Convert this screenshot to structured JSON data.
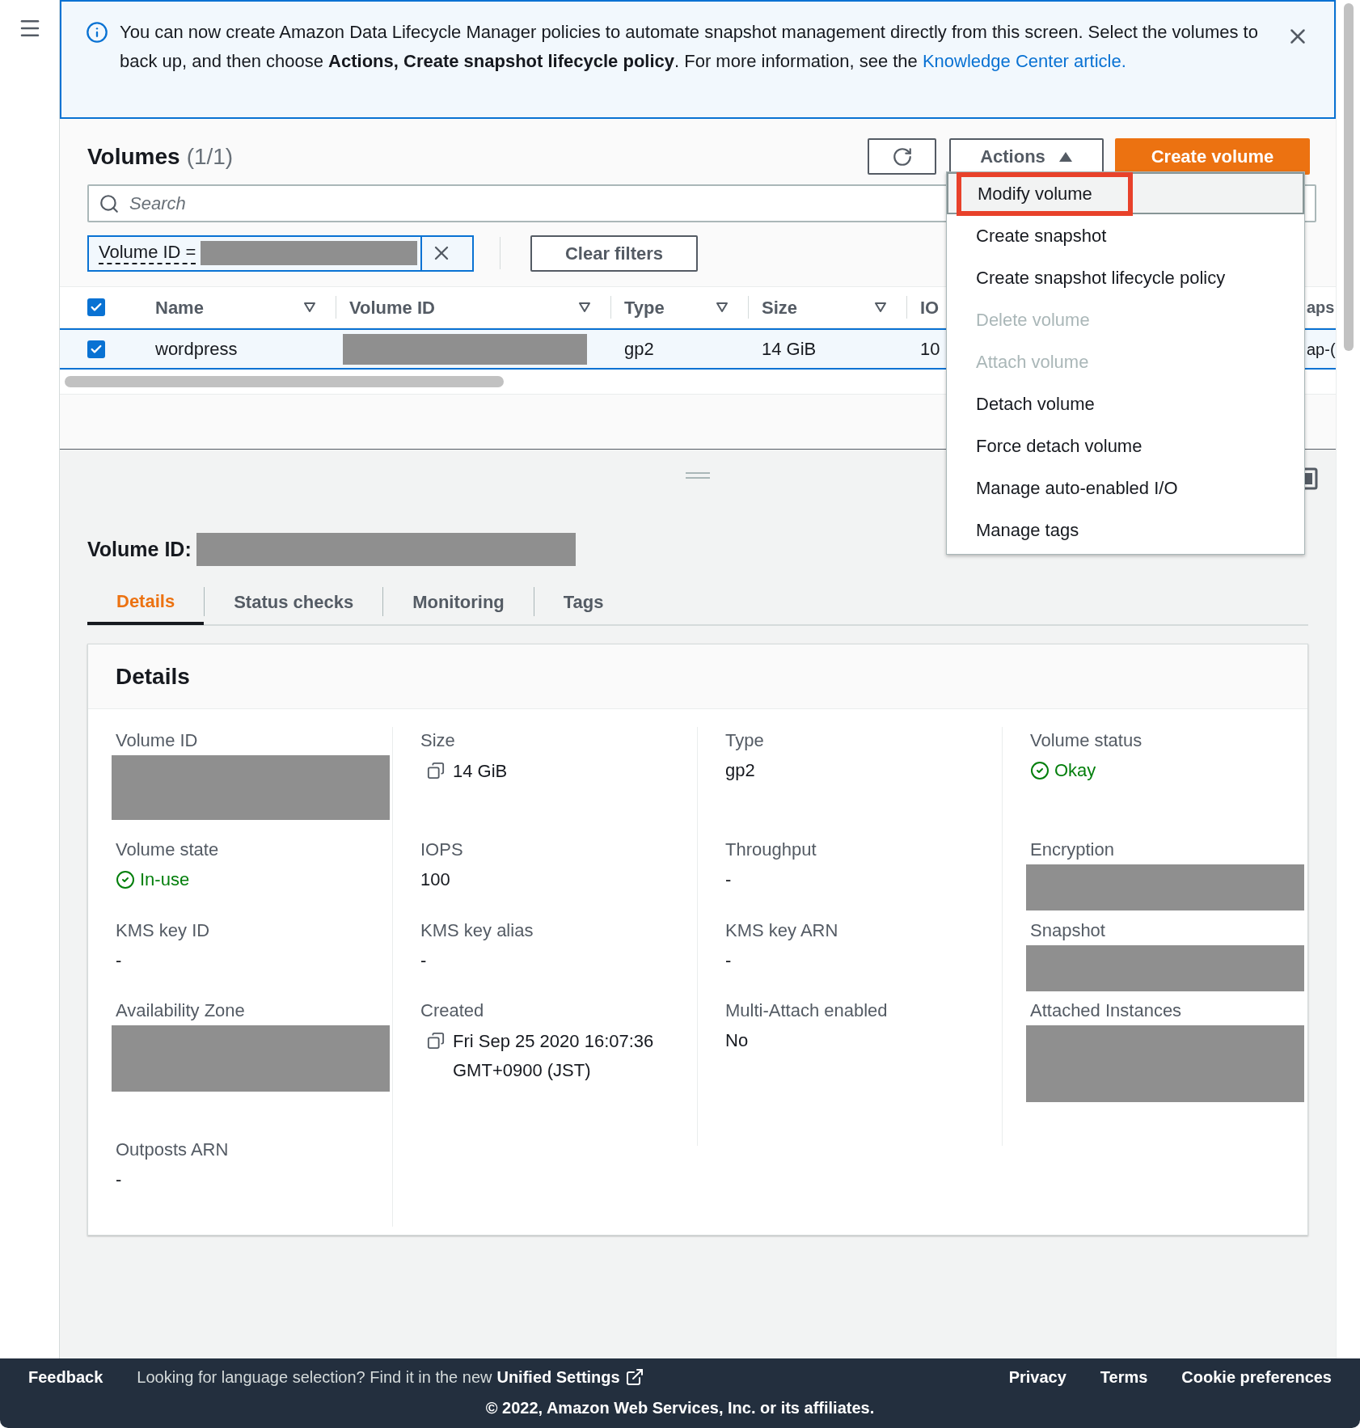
{
  "banner": {
    "text": "You can now create Amazon Data Lifecycle Manager policies to automate snapshot management directly from this screen. Select the volumes to back up, and then choose **Actions, Create snapshot lifecycle policy**. For more information, see the",
    "link": "Knowledge Center article."
  },
  "volumes": {
    "title": "Volumes",
    "count": "(1/1)",
    "actions_label": "Actions",
    "create_label": "Create volume",
    "search_placeholder": "Search",
    "filter_label": "Volume ID =",
    "clear_label": "Clear filters"
  },
  "table": {
    "select_all": true,
    "columns": [
      {
        "label": "Name",
        "filter": true
      },
      {
        "label": "Volume ID",
        "filter": true
      },
      {
        "label": "Type",
        "filter": true
      },
      {
        "label": "Size",
        "filter": true
      },
      {
        "label": "IO",
        "filter": false
      },
      {
        "label": "aps",
        "filter": false
      }
    ],
    "rows": [
      {
        "selected": true,
        "cells": [
          {
            "kind": "text",
            "text": "wordpress"
          },
          {
            "kind": "redacted"
          },
          {
            "kind": "text",
            "text": "gp2"
          },
          {
            "kind": "text",
            "text": "14 GiB"
          },
          {
            "kind": "text",
            "text": "10"
          },
          {
            "kind": "text",
            "text": "ap-("
          }
        ]
      }
    ]
  },
  "menu": [
    {
      "label": "Modify volume",
      "selected": true,
      "disabled": false
    },
    {
      "label": "Create snapshot",
      "selected": false,
      "disabled": false
    },
    {
      "label": "Create snapshot lifecycle policy",
      "selected": false,
      "disabled": false
    },
    {
      "label": "Delete volume",
      "selected": false,
      "disabled": true
    },
    {
      "label": "Attach volume",
      "selected": false,
      "disabled": true
    },
    {
      "label": "Detach volume",
      "selected": false,
      "disabled": false
    },
    {
      "label": "Force detach volume",
      "selected": false,
      "disabled": false
    },
    {
      "label": "Manage auto-enabled I/O",
      "selected": false,
      "disabled": false
    },
    {
      "label": "Manage tags",
      "selected": false,
      "disabled": false
    }
  ],
  "detail_title": "Volume ID:",
  "tabs": [
    {
      "label": "Details",
      "selected": true
    },
    {
      "label": "Status checks",
      "selected": false
    },
    {
      "label": "Monitoring",
      "selected": false
    },
    {
      "label": "Tags",
      "selected": false
    }
  ],
  "details": {
    "title": "Details",
    "columns": [
      [
        {
          "label": "Volume ID",
          "kind": "redacted"
        },
        {
          "label": "Volume state",
          "kind": "status",
          "value": "In-use"
        },
        {
          "label": "KMS key ID",
          "kind": "text",
          "value": "-"
        },
        {
          "label": "Availability Zone",
          "kind": "redacted"
        },
        {
          "label": "Outposts ARN",
          "kind": "text",
          "value": "-"
        }
      ],
      [
        {
          "label": "Size",
          "kind": "copy",
          "value": "14 GiB"
        },
        {
          "label": "IOPS",
          "kind": "text",
          "value": "100"
        },
        {
          "label": "KMS key alias",
          "kind": "text",
          "value": "-"
        },
        {
          "label": "Created",
          "kind": "copy",
          "value": "Fri Sep 25 2020 16:07:36 GMT+0900 (JST)"
        }
      ],
      [
        {
          "label": "Type",
          "kind": "text",
          "value": "gp2"
        },
        {
          "label": "Throughput",
          "kind": "text",
          "value": "-"
        },
        {
          "label": "KMS key ARN",
          "kind": "text",
          "value": "-"
        },
        {
          "label": "Multi-Attach enabled",
          "kind": "text",
          "value": "No"
        }
      ],
      [
        {
          "label": "Volume status",
          "kind": "status",
          "value": "Okay"
        },
        {
          "label": "Encryption",
          "kind": "redacted"
        },
        {
          "label": "Snapshot",
          "kind": "redacted"
        },
        {
          "label": "Attached Instances",
          "kind": "redacted"
        }
      ]
    ]
  },
  "footer": {
    "feedback": "Feedback",
    "language_note": "Looking for language selection? Find it in the new",
    "unified_settings": "Unified Settings",
    "links": [
      "Privacy",
      "Terms",
      "Cookie preferences"
    ],
    "copyright": "© 2022, Amazon Web Services, Inc. or its affiliates."
  }
}
